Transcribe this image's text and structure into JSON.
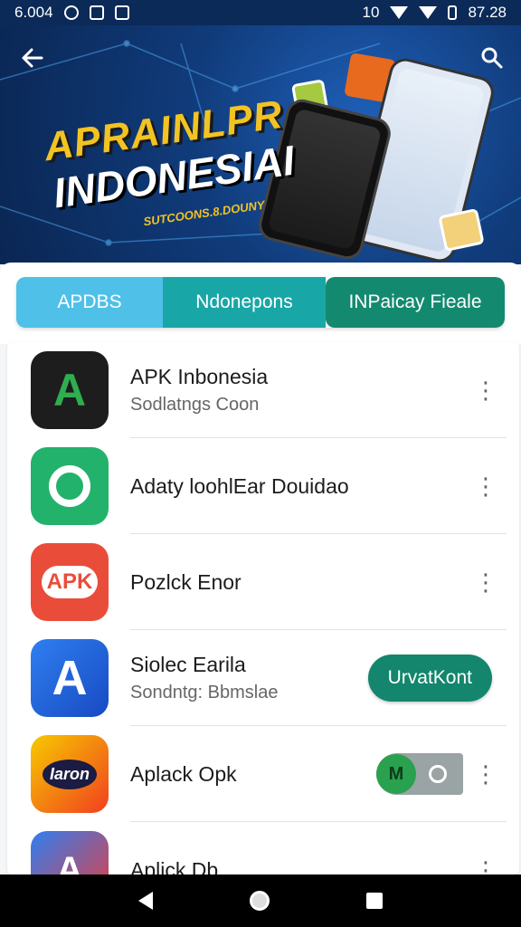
{
  "status_bar": {
    "time_left": "6.004",
    "time_right": "87.28",
    "signal_text": "10"
  },
  "hero": {
    "title_line1": "APRAINLPR",
    "title_line2": "INDONESIAI",
    "subtitle": "SUTCOONS.8.DOUNY"
  },
  "tabs": [
    {
      "label": "APDBS"
    },
    {
      "label": "Ndonepons"
    },
    {
      "label": "INPaicay Fieale"
    }
  ],
  "apps": [
    {
      "title": "APK Inbonesia",
      "subtitle": "Sodlatngs Coon",
      "icon_text": "A"
    },
    {
      "title": "Adaty loohlEar Douidao",
      "subtitle": "",
      "icon_text": ""
    },
    {
      "title": "Pozlck Enor",
      "subtitle": "",
      "icon_text": "APK"
    },
    {
      "title": "Siolec Earila",
      "subtitle": "Sondntg: Bbmslae",
      "icon_text": "A",
      "action": "UrvatKont"
    },
    {
      "title": "Aplack Opk",
      "subtitle": "",
      "icon_text": "Iaron",
      "toggle_text": "M"
    },
    {
      "title": "Aplick Db",
      "subtitle": "",
      "icon_text": "A"
    }
  ],
  "icons": {
    "back": "arrow-left-icon",
    "search": "search-icon",
    "menu": "more-vertical-icon"
  },
  "colors": {
    "accent": "#13866d",
    "tab_a": "#4fc0e8",
    "tab_b": "#19a6a7",
    "tab_c": "#138a6f"
  }
}
